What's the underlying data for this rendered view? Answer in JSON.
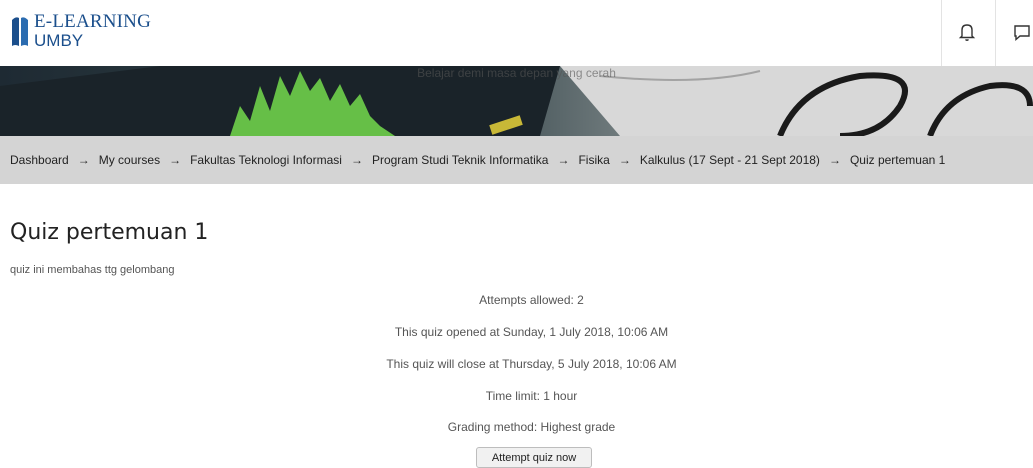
{
  "brand": {
    "line1": "E-LEARNING",
    "line2": "UMBY"
  },
  "navbar": {
    "icons": [
      {
        "name": "bell-icon"
      },
      {
        "name": "chat-icon"
      }
    ]
  },
  "banner": {
    "tagline": "Belajar demi masa depan yang cerah"
  },
  "breadcrumb": {
    "separator": "→",
    "items": [
      "Dashboard",
      "My courses",
      "Fakultas Teknologi Informasi",
      "Program Studi Teknik Informatika",
      "Fisika",
      "Kalkulus (17 Sept - 21 Sept 2018)",
      "Quiz pertemuan 1"
    ]
  },
  "quiz": {
    "title": "Quiz pertemuan 1",
    "intro": "quiz ini membahas ttg gelombang",
    "info": [
      "Attempts allowed: 2",
      "This quiz opened at Sunday, 1 July 2018, 10:06 AM",
      "This quiz will close at Thursday, 5 July 2018, 10:06 AM",
      "Time limit: 1 hour",
      "Grading method: Highest grade"
    ],
    "attempt_button": "Attempt quiz now"
  }
}
